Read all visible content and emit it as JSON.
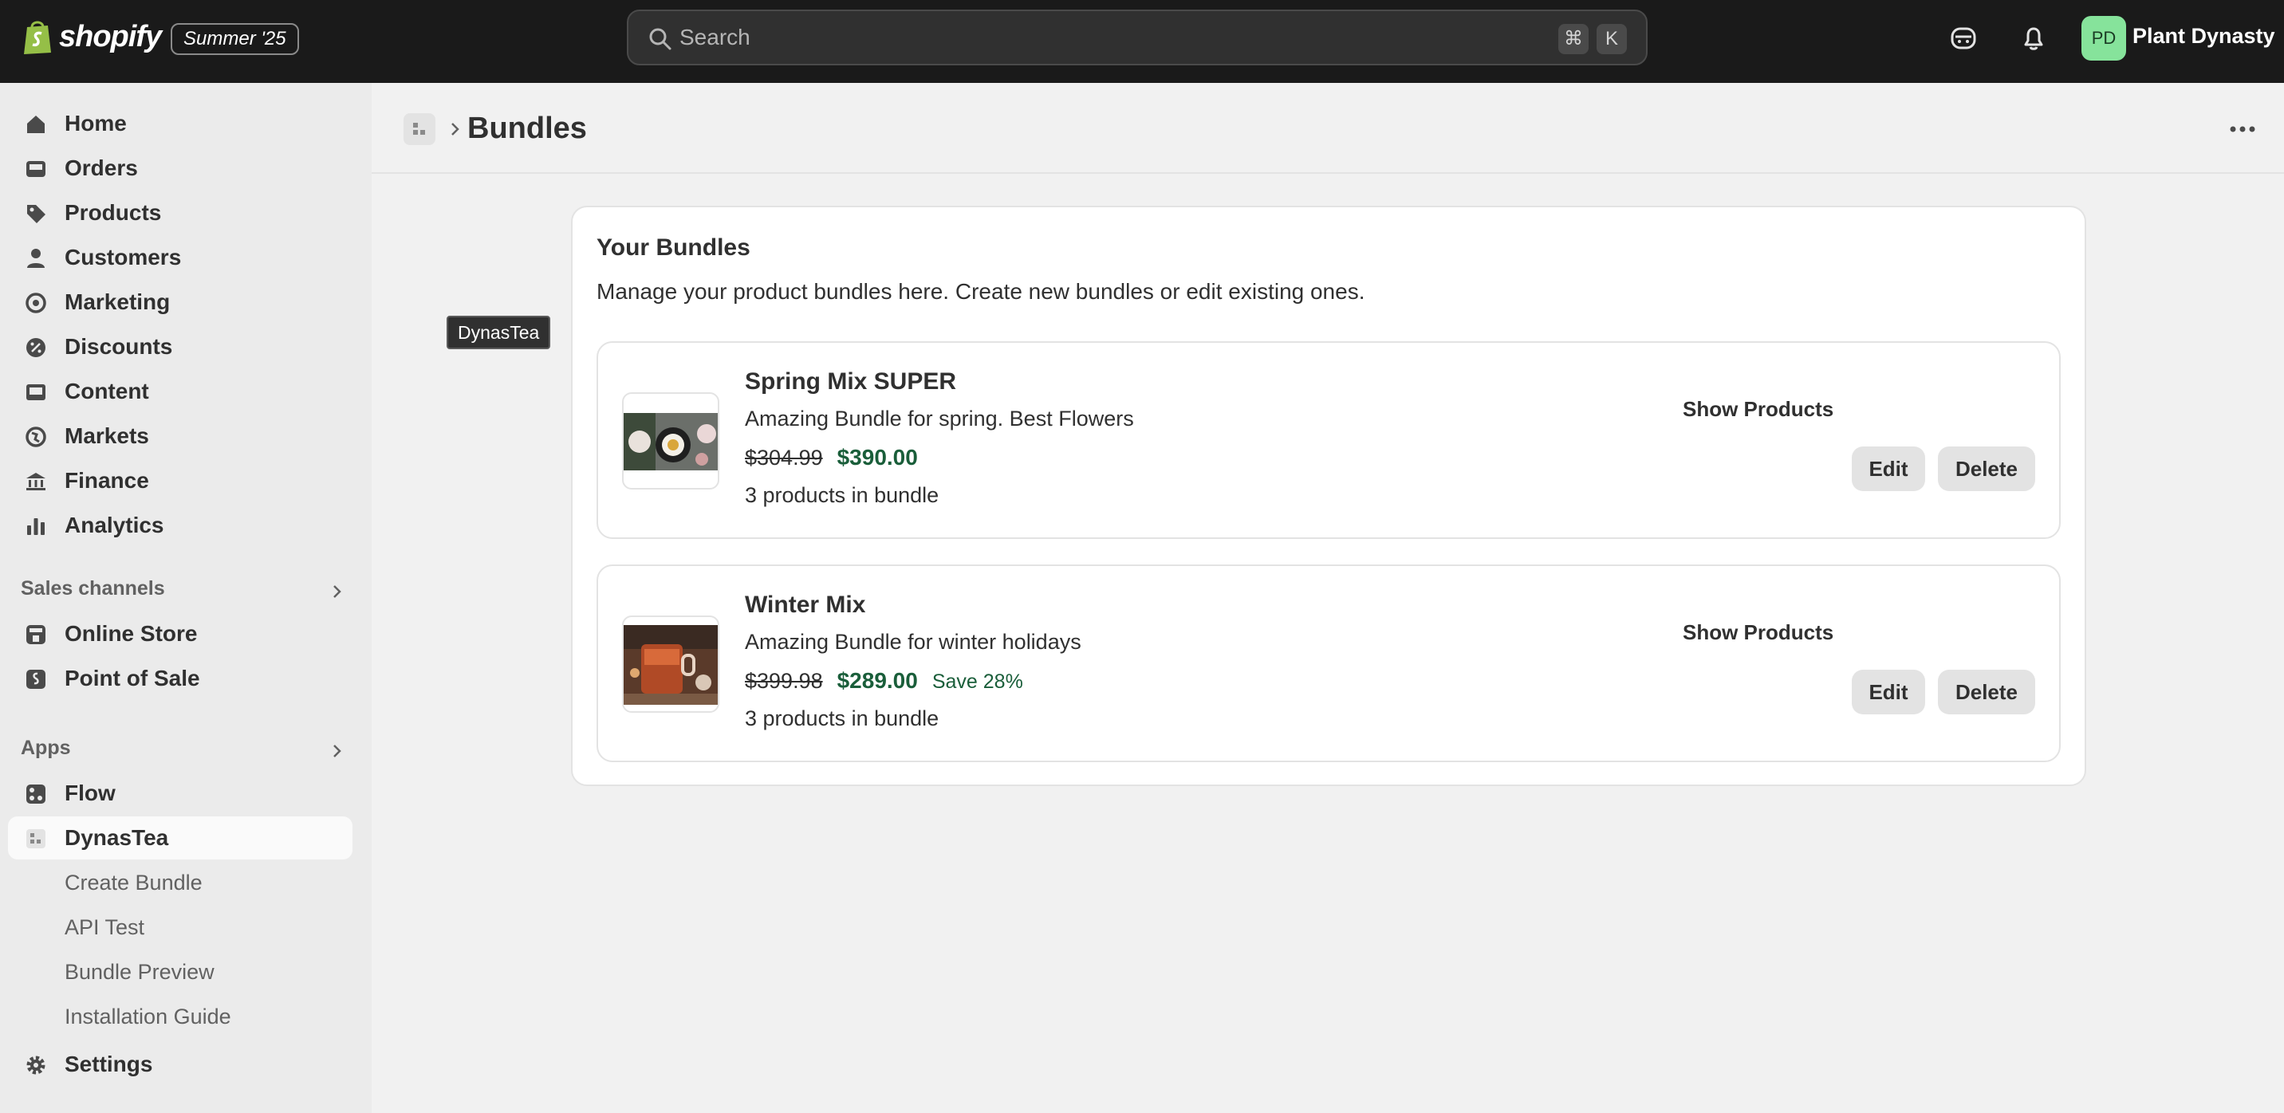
{
  "topbar": {
    "logo_text": "shopify",
    "edition_badge": "Summer '25",
    "search_placeholder": "Search",
    "shortcut_cmd": "⌘",
    "shortcut_key": "K",
    "avatar_initials": "PD",
    "store_name": "Plant Dynasty",
    "icons": [
      "shopify-bag-icon",
      "search-icon",
      "sidekick-icon",
      "bell-icon"
    ]
  },
  "sidebar": {
    "main_items": [
      {
        "label": "Home",
        "icon": "home-icon"
      },
      {
        "label": "Orders",
        "icon": "inbox-icon"
      },
      {
        "label": "Products",
        "icon": "tag-icon"
      },
      {
        "label": "Customers",
        "icon": "person-icon"
      },
      {
        "label": "Marketing",
        "icon": "target-icon"
      },
      {
        "label": "Discounts",
        "icon": "discount-icon"
      },
      {
        "label": "Content",
        "icon": "image-icon"
      },
      {
        "label": "Markets",
        "icon": "globe-icon"
      },
      {
        "label": "Finance",
        "icon": "bank-icon"
      },
      {
        "label": "Analytics",
        "icon": "bar-chart-icon"
      }
    ],
    "sales_channels_label": "Sales channels",
    "sales_channels": [
      {
        "label": "Online Store",
        "icon": "store-icon"
      },
      {
        "label": "Point of Sale",
        "icon": "pos-icon"
      }
    ],
    "apps_label": "Apps",
    "apps": [
      {
        "label": "Flow",
        "icon": "flow-icon"
      },
      {
        "label": "DynasTea",
        "icon": "app-icon",
        "active": true
      }
    ],
    "app_sub_items": [
      "Create Bundle",
      "API Test",
      "Bundle Preview",
      "Installation Guide"
    ],
    "settings_label": "Settings"
  },
  "header": {
    "title": "Bundles"
  },
  "tooltip": "DynasTea",
  "card": {
    "title": "Your Bundles",
    "description": "Manage your product bundles here. Create new bundles or edit existing ones.",
    "bundles": [
      {
        "name": "Spring Mix SUPER",
        "description": "Amazing Bundle for spring. Best Flowers",
        "old_price": "$304.99",
        "new_price": "$390.00",
        "save": "",
        "count": "3 products in bundle",
        "show_products": "Show Products",
        "edit": "Edit",
        "delete": "Delete"
      },
      {
        "name": "Winter Mix",
        "description": "Amazing Bundle for winter holidays",
        "old_price": "$399.98",
        "new_price": "$289.00",
        "save": "Save 28%",
        "count": "3 products in bundle",
        "show_products": "Show Products",
        "edit": "Edit",
        "delete": "Delete"
      }
    ]
  },
  "colors": {
    "topbar_bg": "#1a1a1a",
    "sidebar_bg": "#ebebeb",
    "page_bg": "#f1f1f1",
    "price_green": "#1a5e3a",
    "avatar_bg": "#86e39b"
  }
}
